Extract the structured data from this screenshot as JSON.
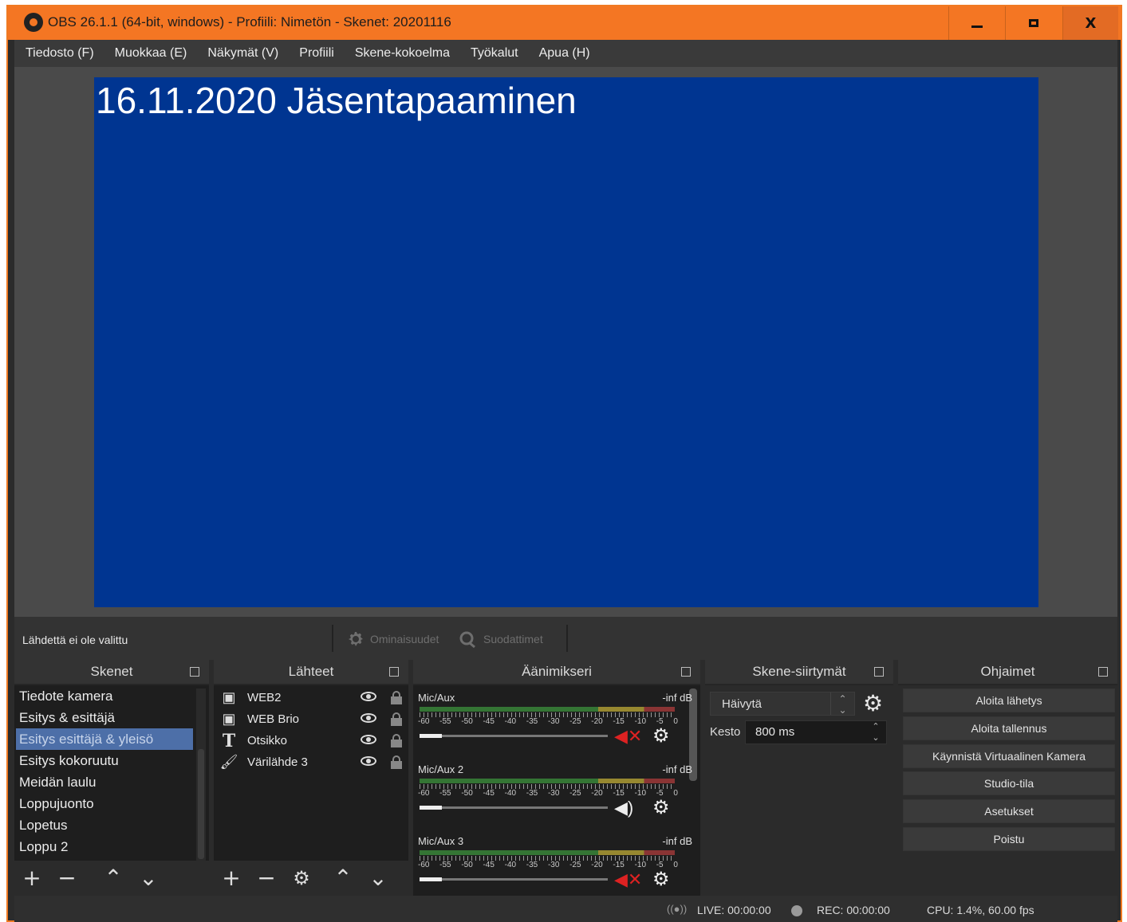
{
  "window": {
    "title": "OBS 26.1.1 (64-bit, windows) - Profiili: Nimetön - Skenet: 20201116",
    "controls": {
      "minimize": "",
      "maximize": "",
      "close": "X"
    }
  },
  "menu": [
    "Tiedosto (F)",
    "Muokkaa (E)",
    "Näkymät (V)",
    "Profiili",
    "Skene-kokoelma",
    "Työkalut",
    "Apua (H)"
  ],
  "preview": {
    "text": "16.11.2020 Jäsentapaaminen",
    "background": "#003591"
  },
  "source_bar": {
    "status": "Lähdettä ei ole valittu",
    "properties": "Ominaisuudet",
    "filters": "Suodattimet"
  },
  "docks": {
    "scenes": {
      "title": "Skenet",
      "items": [
        "Tiedote kamera",
        "Esitys & esittäjä",
        "Esitys esittäjä & yleisö",
        "Esitys kokoruutu",
        "Meidän laulu",
        "Loppujuonto",
        "Lopetus",
        "Loppu 2"
      ],
      "selected_index": 2
    },
    "sources": {
      "title": "Lähteet",
      "items": [
        {
          "icon": "camera-icon",
          "label": "WEB2"
        },
        {
          "icon": "camera-icon",
          "label": "WEB Brio"
        },
        {
          "icon": "text-icon",
          "label": "Otsikko"
        },
        {
          "icon": "brush-icon",
          "label": "Värilähde 3"
        }
      ]
    },
    "mixer": {
      "title": "Äänimikseri",
      "tick_labels": [
        "-60",
        "-55",
        "-50",
        "-45",
        "-40",
        "-35",
        "-30",
        "-25",
        "-20",
        "-15",
        "-10",
        "-5",
        "0"
      ],
      "channels": [
        {
          "name": "Mic/Aux",
          "level": "-inf dB",
          "muted": true
        },
        {
          "name": "Mic/Aux 2",
          "level": "-inf dB",
          "muted": false
        },
        {
          "name": "Mic/Aux 3",
          "level": "-inf dB",
          "muted": true
        }
      ]
    },
    "transitions": {
      "title": "Skene-siirtymät",
      "selected": "Häivytä",
      "duration_label": "Kesto",
      "duration_value": "800 ms"
    },
    "controls": {
      "title": "Ohjaimet",
      "buttons": [
        "Aloita lähetys",
        "Aloita tallennus",
        "Käynnistä Virtuaalinen Kamera",
        "Studio-tila",
        "Asetukset",
        "Poistu"
      ]
    }
  },
  "status": {
    "live": "LIVE: 00:00:00",
    "rec": "REC: 00:00:00",
    "cpu": "CPU: 1.4%, 60.00 fps"
  },
  "colors": {
    "accent": "#f47623",
    "selection": "#4d6fa8"
  }
}
